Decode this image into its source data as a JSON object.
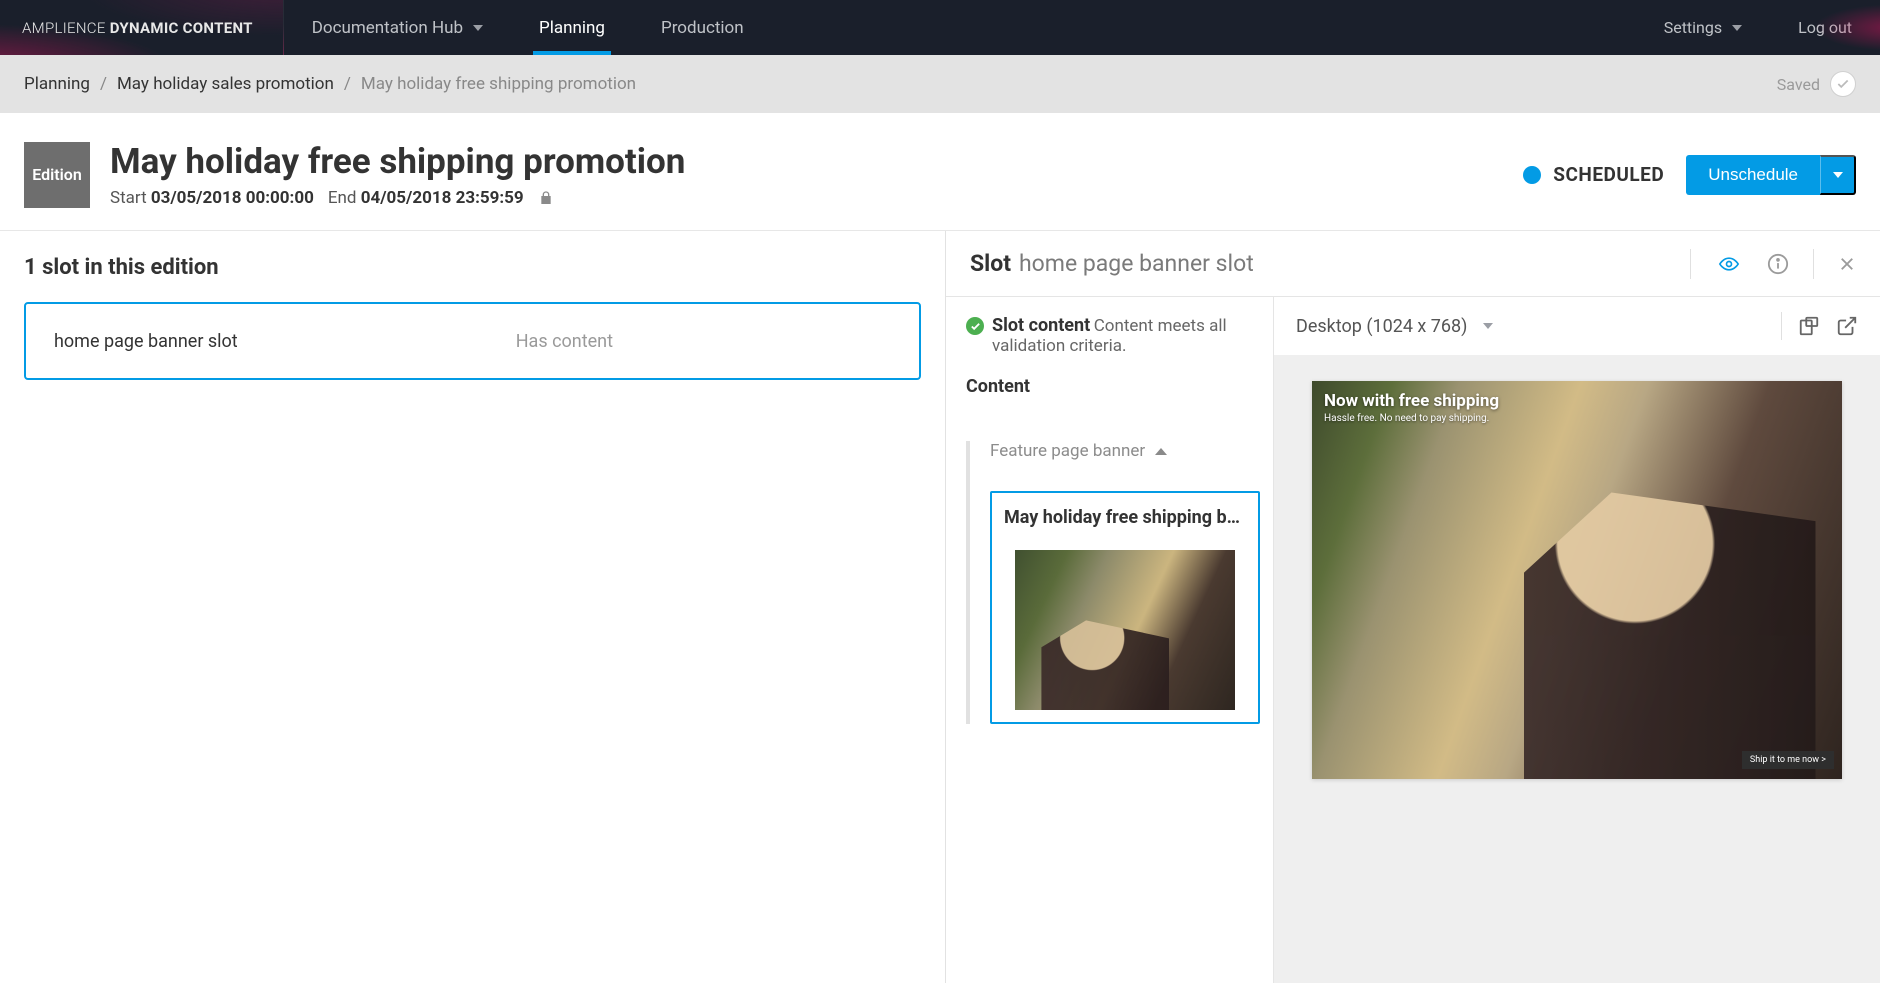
{
  "brand": {
    "thin": "AMPLIENCE",
    "bold": "DYNAMIC CONTENT"
  },
  "nav": {
    "doc_hub": "Documentation Hub",
    "planning": "Planning",
    "production": "Production",
    "settings": "Settings",
    "logout": "Log out"
  },
  "breadcrumb": {
    "seg1": "Planning",
    "seg2": "May holiday sales promotion",
    "seg3": "May holiday free shipping promotion",
    "saved": "Saved"
  },
  "edition": {
    "badge": "Edition",
    "title": "May holiday free shipping promotion",
    "start_label": "Start",
    "start_value": "03/05/2018 00:00:00",
    "end_label": "End",
    "end_value": "04/05/2018 23:59:59",
    "status": "SCHEDULED",
    "unschedule": "Unschedule"
  },
  "slots": {
    "heading": "1 slot in this edition",
    "items": [
      {
        "name": "home page banner slot",
        "status": "Has content"
      }
    ]
  },
  "slot_panel": {
    "header_label": "Slot",
    "header_name": "home page banner slot",
    "content_status_title": "Slot content",
    "content_status_desc": "Content meets all validation criteria.",
    "content_heading": "Content",
    "accordion_title": "Feature page banner",
    "card_title": "May holiday free shipping b…"
  },
  "preview": {
    "device": "Desktop (1024 x 768)",
    "overlay_title": "Now with free shipping",
    "overlay_sub": "Hassle free. No need to pay shipping.",
    "cta": "Ship it to me now >"
  }
}
